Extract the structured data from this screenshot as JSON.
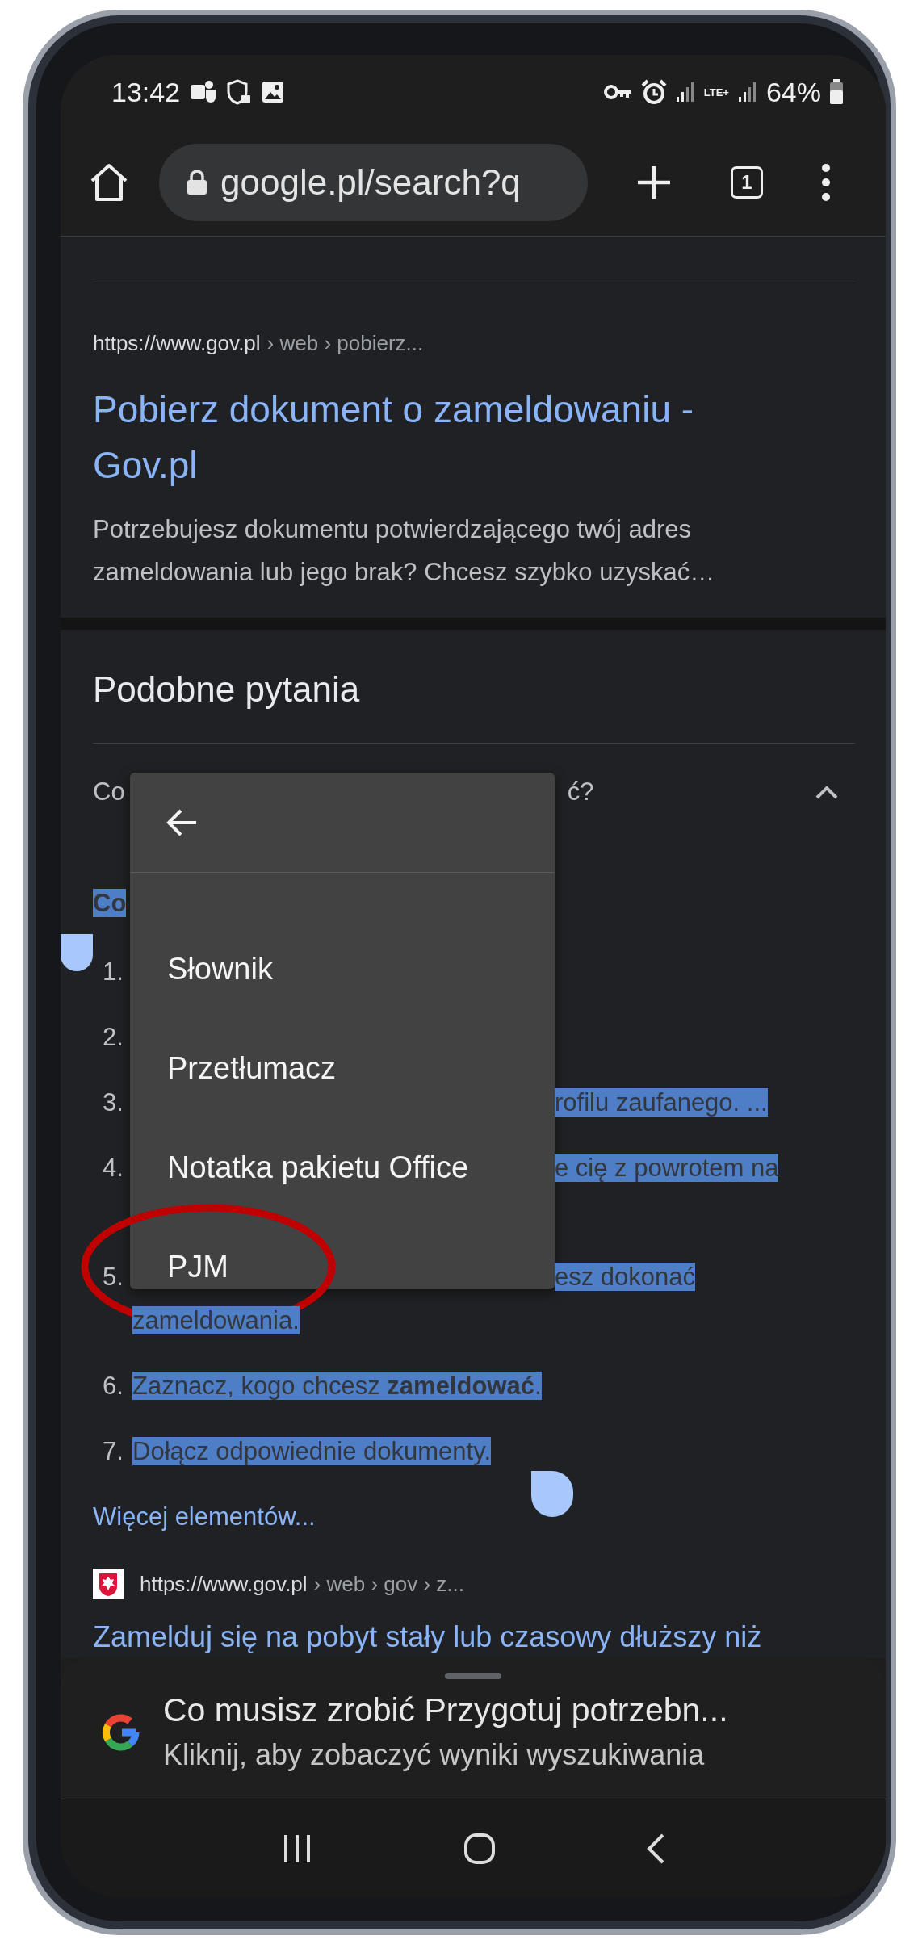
{
  "status_bar": {
    "time": "13:42",
    "network": "LTE+",
    "battery": "64%"
  },
  "toolbar": {
    "url": "google.pl/search?q",
    "tab_count": "1"
  },
  "result": {
    "domain": "https://www.gov.pl",
    "path": "› web › pobierz...",
    "title": "Pobierz dokument o zameldowaniu - Gov.pl",
    "snippet": "Potrzebujesz dokumentu potwierdzającego twój adres zameldowania lub jego brak? Chcesz szybko uzyskać…"
  },
  "related_questions": {
    "heading": "Podobne pytania",
    "question_start": "Co",
    "question_end": "ć?",
    "expanded": true,
    "answer_heading": "Co",
    "answer_items": [
      {
        "number": "1."
      },
      {
        "number": "2."
      },
      {
        "number": "3.",
        "text_right": "rofilu zaufanego. ...",
        "highlighted": true
      },
      {
        "number": "4.",
        "text_right": "e cię z powrotem na",
        "hidden_continuation": true,
        "highlighted": true
      },
      {
        "number": "5.",
        "text_right": "esz dokonać",
        "text": "zameldowania.",
        "highlighted": true
      },
      {
        "number": "6.",
        "text": "Zaznacz, kogo chcesz **zameldować**.",
        "highlighted": true
      },
      {
        "number": "7.",
        "text": "Dołącz odpowiednie dokumenty.",
        "highlighted": true
      }
    ],
    "more_link": "Więcej elementów..."
  },
  "next_result": {
    "domain": "https://www.gov.pl",
    "path": "› web › gov › z...",
    "title": "Zamelduj się na pobyt stały lub czasowy dłuższy niż"
  },
  "context_menu": {
    "items": [
      {
        "label": "Słownik"
      },
      {
        "label": "Przetłumacz"
      },
      {
        "label": "Notatka pakietu Office"
      },
      {
        "label": "PJM"
      }
    ]
  },
  "annotation": {
    "kind": "ellipse"
  },
  "bottom_sheet": {
    "title": "Co musisz zrobić Przygotuj potrzebn...",
    "subtitle": "Kliknij, aby zobaczyć wyniki wyszukiwania"
  }
}
